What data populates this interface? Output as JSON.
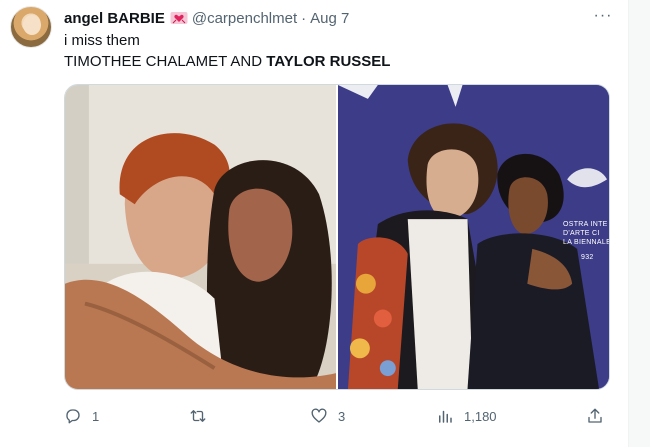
{
  "tweet": {
    "author": {
      "display_name": "angel BARBIE",
      "badge_icon": "heart-ribbon-emoji-icon",
      "handle": "@carpenchlmet",
      "separator": "·",
      "date": "Aug 7"
    },
    "more_label": "···",
    "text_line1": "i miss them",
    "text_line2_prefix": "TIMOTHEE CHALAMET AND ",
    "text_line2_bold": "TAYLOR RUSSEL",
    "media": {
      "count": 2,
      "right_backdrop_text": [
        "OSTRA INTE",
        "D'ARTE CI",
        "LA BIENNALE",
        "932"
      ]
    },
    "actions": {
      "reply": {
        "icon": "reply-icon",
        "count": "1"
      },
      "retweet": {
        "icon": "retweet-icon",
        "count": ""
      },
      "like": {
        "icon": "heart-icon",
        "count": "3"
      },
      "views": {
        "icon": "views-chart-icon",
        "count": "1,180"
      },
      "share": {
        "icon": "share-icon",
        "count": ""
      }
    },
    "colors": {
      "text_primary": "#0f1419",
      "text_secondary": "#536471",
      "border": "#cfd9de",
      "backdrop_blue": "#3e3d8a"
    }
  }
}
